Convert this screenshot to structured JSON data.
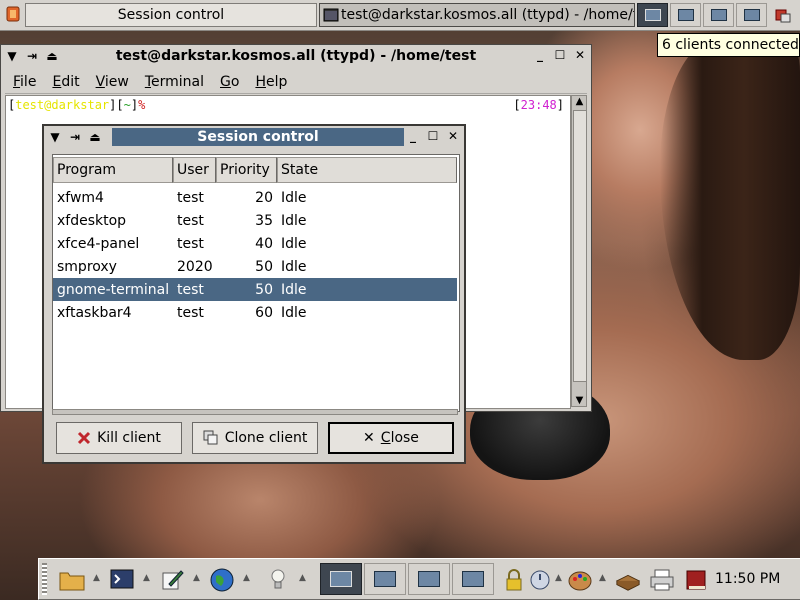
{
  "top_panel": {
    "tasks": [
      {
        "label": "Session control",
        "active": false
      },
      {
        "label": "test@darkstar.kosmos.all (ttypd) - /home/test",
        "active": true
      }
    ],
    "workspaces": 4,
    "active_workspace": 1,
    "tooltip": "6 clients connected"
  },
  "terminal": {
    "title": "test@darkstar.kosmos.all (ttypd) - /home/test",
    "menu": [
      {
        "label": "File",
        "key": "F",
        "rest": "ile"
      },
      {
        "label": "Edit",
        "key": "E",
        "rest": "dit"
      },
      {
        "label": "View",
        "key": "V",
        "rest": "iew"
      },
      {
        "label": "Terminal",
        "key": "T",
        "rest": "erminal"
      },
      {
        "label": "Go",
        "key": "G",
        "rest": "o"
      },
      {
        "label": "Help",
        "key": "H",
        "rest": "elp"
      }
    ],
    "prompt": {
      "open": "[",
      "userhost": "test@darkstar",
      "mid": "][",
      "dir": "~",
      "close": "]",
      "symbol": "%"
    },
    "time": {
      "open": "[",
      "value": "23:48",
      "close": "]"
    }
  },
  "dialog": {
    "title": "Session control",
    "columns": [
      "Program",
      "User",
      "Priority",
      "State"
    ],
    "rows": [
      {
        "program": "xfwm4",
        "user": "test",
        "priority": "20",
        "state": "Idle",
        "selected": false
      },
      {
        "program": "xfdesktop",
        "user": "test",
        "priority": "35",
        "state": "Idle",
        "selected": false
      },
      {
        "program": "xfce4-panel",
        "user": "test",
        "priority": "40",
        "state": "Idle",
        "selected": false
      },
      {
        "program": "smproxy",
        "user": "2020",
        "priority": "50",
        "state": "Idle",
        "selected": false
      },
      {
        "program": "gnome-terminal",
        "user": "test",
        "priority": "50",
        "state": "Idle",
        "selected": true
      },
      {
        "program": "xftaskbar4",
        "user": "test",
        "priority": "60",
        "state": "Idle",
        "selected": false
      }
    ],
    "buttons": {
      "kill": "Kill client",
      "clone": "Clone client",
      "close": "Close"
    }
  },
  "bottom_panel": {
    "launchers": [
      "folder-icon",
      "terminal-icon",
      "editor-icon",
      "globe-icon",
      "lightbulb-icon"
    ],
    "tray": [
      "lock-icon",
      "power-icon",
      "palette-icon",
      "mailbox-icon",
      "printer-icon",
      "book-icon"
    ],
    "workspaces": 4,
    "active_workspace": 1,
    "clock": "11:50 PM"
  },
  "colors": {
    "selection": "#4a6784",
    "panel": "#d6d3ce",
    "tooltip_bg": "#ffffe1"
  }
}
